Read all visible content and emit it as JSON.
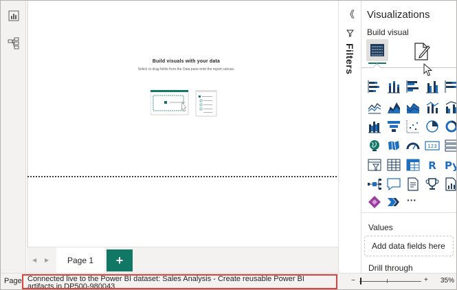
{
  "left_rail": {
    "items": [
      {
        "name": "report-view",
        "icon": "bar-chart-icon"
      },
      {
        "name": "model-view",
        "icon": "model-icon"
      }
    ]
  },
  "canvas": {
    "empty_title": "Build visuals with your data",
    "empty_subtitle": "Select or drag fields from the Data pane onto the report canvas."
  },
  "pages": {
    "tabs": [
      {
        "label": "Page 1"
      }
    ],
    "add_label": "+",
    "nav_prev": "◀",
    "nav_next": "▶"
  },
  "status_bar": {
    "page_label": "Page",
    "message": "Connected live to the Power BI dataset: Sales Analysis - Create reusable Power BI artifacts in DP500-980043",
    "zoom_minus": "−",
    "zoom_plus": "+",
    "zoom_level": "35%"
  },
  "filters": {
    "collapse_label": "《",
    "label": "Filters"
  },
  "visualizations": {
    "title": "Visualizations",
    "build_visual": "Build visual",
    "more_label": "···",
    "values_label": "Values",
    "values_placeholder": "Add data fields here",
    "drill_through_label": "Drill through"
  },
  "colors": {
    "accent": "#117865",
    "highlight_border": "#e0403a",
    "chart_blue": "#1f6fc0",
    "chart_dark": "#1b3a5c"
  }
}
